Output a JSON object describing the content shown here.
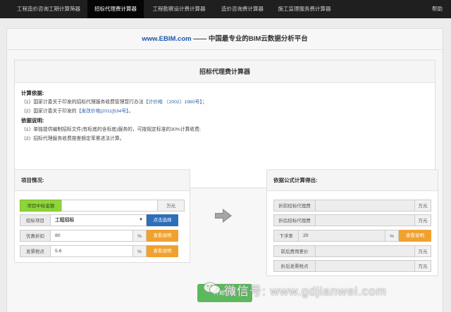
{
  "topnav": {
    "tabs": [
      {
        "label": "工程造价咨询工期计算筛器",
        "active": false
      },
      {
        "label": "招标代理费计算器",
        "active": true
      },
      {
        "label": "工程勘察设计费计算器",
        "active": false
      },
      {
        "label": "造价咨询费计算器",
        "active": false
      },
      {
        "label": "施工监理服务费计算器",
        "active": false
      }
    ],
    "help": "帮助"
  },
  "banner": {
    "site": "www.EBIM.com",
    "tagline": "—— 中国最专业的BIM云数据分析平台"
  },
  "calculator": {
    "title": "招标代理费计算器",
    "basis_heading": "计算依据:",
    "basis_1_prefix": "（1）国家计委关于印发的招标代理服务收费管理暂行办法",
    "basis_1_doc": "【计价格 〔2002〕1980号】",
    "basis_1_suffix": "；",
    "basis_2_prefix": "（2）国家计委关于印发的",
    "basis_2_doc": "【发改价格[2011]534号】",
    "basis_2_suffix": "。",
    "notes_heading": "依据说明:",
    "note_1": "（1）单独提供编制招标文件(有标底的含标底)服务的，可按规定标准的30%计算收费;",
    "note_2": "（2）招标代理服务收费按差额定率累进法计算。"
  },
  "project": {
    "heading": "项目情况:",
    "bid_amount_label": "项目中标金额",
    "bid_amount_value": "",
    "bid_amount_unit": "万元",
    "bid_item_label": "招标项目",
    "bid_item_value": "工程招标",
    "bid_item_button": "点击选择",
    "discount_label": "优惠折扣",
    "discount_value": "80",
    "discount_unit": "%",
    "discount_button": "查看说明",
    "tax_label": "发票税点",
    "tax_value": "5.6",
    "tax_unit": "%",
    "tax_button": "查看说明"
  },
  "result": {
    "heading": "依据公式计算得出:",
    "rows": [
      {
        "label": "折前招标代理费",
        "value": "",
        "unit": "万元"
      },
      {
        "label": "折后招标代理费",
        "value": "",
        "unit": "万元"
      },
      {
        "label": "下浮率",
        "value": "20",
        "unit": "%",
        "button": "查看说明"
      },
      {
        "label": "前后费用差价",
        "value": "",
        "unit": "万元"
      },
      {
        "label": "折后发票税点",
        "value": "",
        "unit": "万元"
      }
    ]
  },
  "actions": {
    "calculate": "开始计算"
  },
  "watermark": {
    "text": "微信号: www.gdjianwei.com"
  },
  "colors": {
    "nav_bg": "#1f1f1f",
    "brand_blue": "#1b56a8",
    "label_green": "#8ed43b",
    "button_blue": "#2d6fb9",
    "button_orange": "#f0a12e",
    "button_green": "#5cb85c"
  },
  "icons": {
    "arrow": "arrow-right-icon",
    "select": "caret-down-icon",
    "watermark": "wechat-icon"
  }
}
